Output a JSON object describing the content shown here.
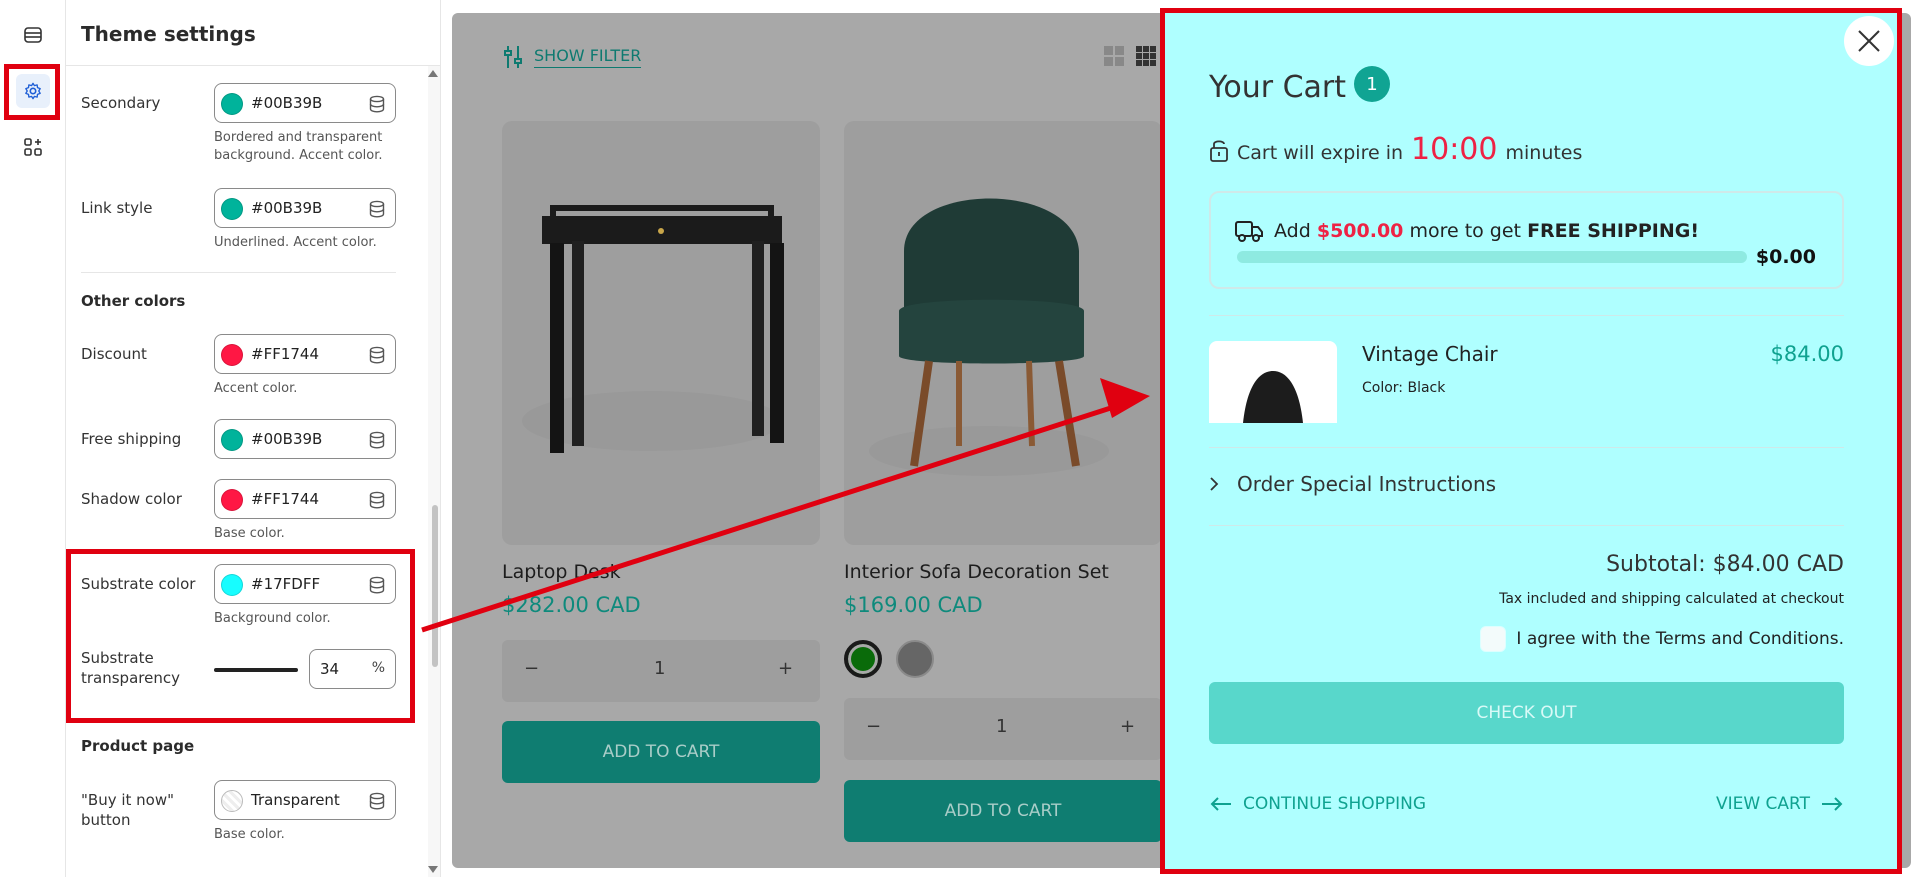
{
  "panel": {
    "title": "Theme settings",
    "secondary": {
      "label": "Secondary",
      "value": "#00B39B",
      "swatch": "#00B39B",
      "help": "Bordered and transparent background. Accent color."
    },
    "link_style": {
      "label": "Link style",
      "value": "#00B39B",
      "swatch": "#00B39B",
      "help": "Underlined. Accent color."
    },
    "other_colors_title": "Other colors",
    "discount": {
      "label": "Discount",
      "value": "#FF1744",
      "swatch": "#FF1744",
      "help": "Accent color."
    },
    "free_shipping": {
      "label": "Free shipping",
      "value": "#00B39B",
      "swatch": "#00B39B"
    },
    "shadow_color": {
      "label": "Shadow color",
      "value": "#FF1744",
      "swatch": "#FF1744",
      "help": "Base color."
    },
    "substrate_color": {
      "label": "Substrate color",
      "value": "#17FDFF",
      "swatch": "#17FDFF",
      "help": "Background color."
    },
    "substrate_transparency": {
      "label_line1": "Substrate",
      "label_line2": "transparency",
      "value": "34",
      "unit": "%",
      "level": 34
    },
    "product_page_title": "Product page",
    "buy_it_now": {
      "label_line1": "\"Buy it now\"",
      "label_line2": "button",
      "value": "Transparent",
      "help": "Base color."
    }
  },
  "preview": {
    "filter_label": "SHOW FILTER",
    "products": [
      {
        "name": "Laptop Desk",
        "price": "$282.00 CAD",
        "qty": "1",
        "add_label": "ADD TO CART"
      },
      {
        "name": "Interior Sofa Decoration Set",
        "price": "$169.00 CAD",
        "qty": "1",
        "add_label": "ADD TO CART"
      }
    ],
    "qty_minus": "−",
    "qty_plus": "+"
  },
  "cart": {
    "title": "Your Cart",
    "count": "1",
    "expire_prefix": "Cart will expire in",
    "expire_time": "10:00",
    "expire_suffix": "minutes",
    "shipping_add": "Add",
    "shipping_amount": "$500.00",
    "shipping_more": "more to get",
    "shipping_free": "FREE SHIPPING!",
    "shipping_total": "$0.00",
    "shipping_progress": 0,
    "item": {
      "name": "Vintage Chair",
      "variant": "Color: Black",
      "price": "$84.00"
    },
    "instructions": "Order Special Instructions",
    "subtotal": "Subtotal: $84.00 CAD",
    "tax_note": "Tax included and shipping calculated at checkout",
    "terms": "I agree with the Terms and Conditions.",
    "checkout_label": "CHECK OUT",
    "continue_label": "CONTINUE SHOPPING",
    "view_cart_label": "VIEW CART"
  },
  "colors": {
    "accent": "#00B39B",
    "discount": "#FF1744",
    "substrate": "#17FDFF",
    "highlight": "#E00010"
  }
}
